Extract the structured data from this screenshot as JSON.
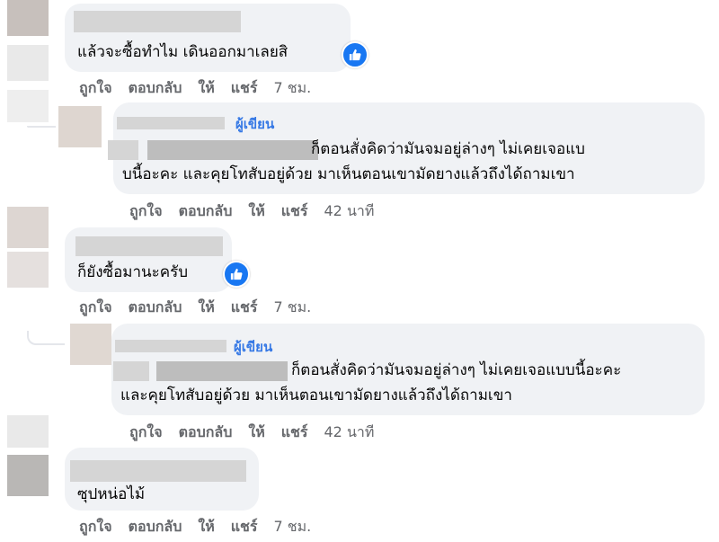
{
  "actions": {
    "like": "ถูกใจ",
    "reply": "ตอบกลับ",
    "give": "ให้",
    "share": "แชร์"
  },
  "author_badge": "ผู้เขียน",
  "comments": [
    {
      "text_lines": [
        "แล้วจะซื้อทำไม เดินออกมาเลยสิ"
      ],
      "time": "7 ชม."
    },
    {
      "text_lines": [
        "ก็ตอนสั่งคิดว่ามันจมอยู่ล่างๆ ไม่เคยเจอแบ",
        "บนี้อะคะ และคุยโทสับอยู่ด้วย มาเห็นตอนเขามัดยางแล้วถึงได้ถามเขา"
      ],
      "time": "42 นาที"
    },
    {
      "text_lines": [
        "ก็ยังซื้อมานะครับ"
      ],
      "time": "7 ชม."
    },
    {
      "text_lines": [
        "ก็ตอนสั่งคิดว่ามันจมอยู่ล่างๆ ไม่เคยเจอแบบนี้อะคะ",
        "และคุยโทสับอยู่ด้วย มาเห็นตอนเขามัดยางแล้วถึงได้ถามเขา"
      ],
      "time": "42 นาที"
    },
    {
      "text_lines": [
        "ซุปหน่อไม้"
      ],
      "time": "7 ชม."
    }
  ],
  "colors": {
    "bubble": "#f0f2f5",
    "author_badge": "#3578e5",
    "like_blue": "#1877f2",
    "muted": "#65676b"
  },
  "icons": {
    "reaction": "thumbs-up-icon"
  }
}
